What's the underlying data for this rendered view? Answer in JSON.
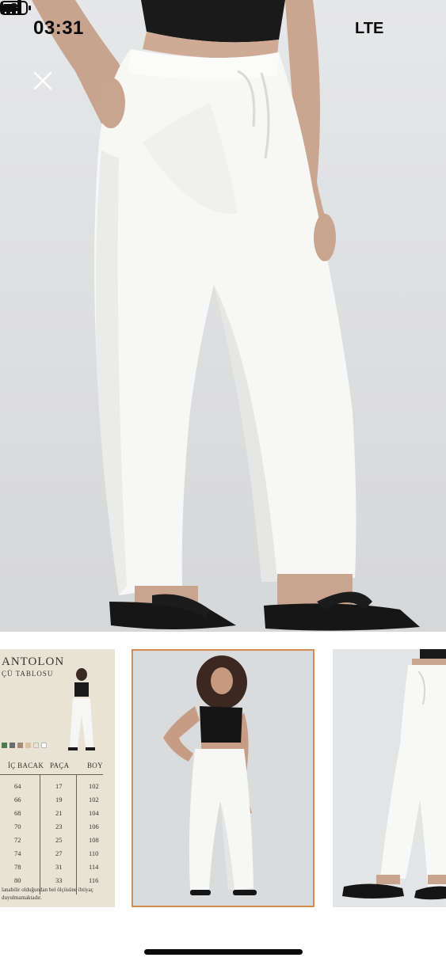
{
  "status_bar": {
    "time": "03:31",
    "network": "LTE",
    "icons": [
      "bed-icon",
      "signal-icon",
      "battery-icon"
    ]
  },
  "viewer": {
    "close_icon": "close-icon"
  },
  "thumbnails": {
    "selected_index": 1,
    "accent_color": "#d98b4e",
    "size_chart": {
      "title": "ANTOLON",
      "subtitle": "ÇÜ TABLOSU",
      "headers": [
        "İÇ BACAK",
        "PAÇA",
        "BOY"
      ],
      "rows": [
        [
          "64",
          "17",
          "102"
        ],
        [
          "66",
          "19",
          "102"
        ],
        [
          "68",
          "21",
          "104"
        ],
        [
          "70",
          "23",
          "106"
        ],
        [
          "72",
          "25",
          "108"
        ],
        [
          "74",
          "27",
          "110"
        ],
        [
          "78",
          "31",
          "114"
        ],
        [
          "80",
          "33",
          "116"
        ]
      ],
      "footer_line1": "lanabilir olduğundan bel ölçüsüne ihtiyaç",
      "footer_line2": "duyulmamaktadır."
    }
  }
}
